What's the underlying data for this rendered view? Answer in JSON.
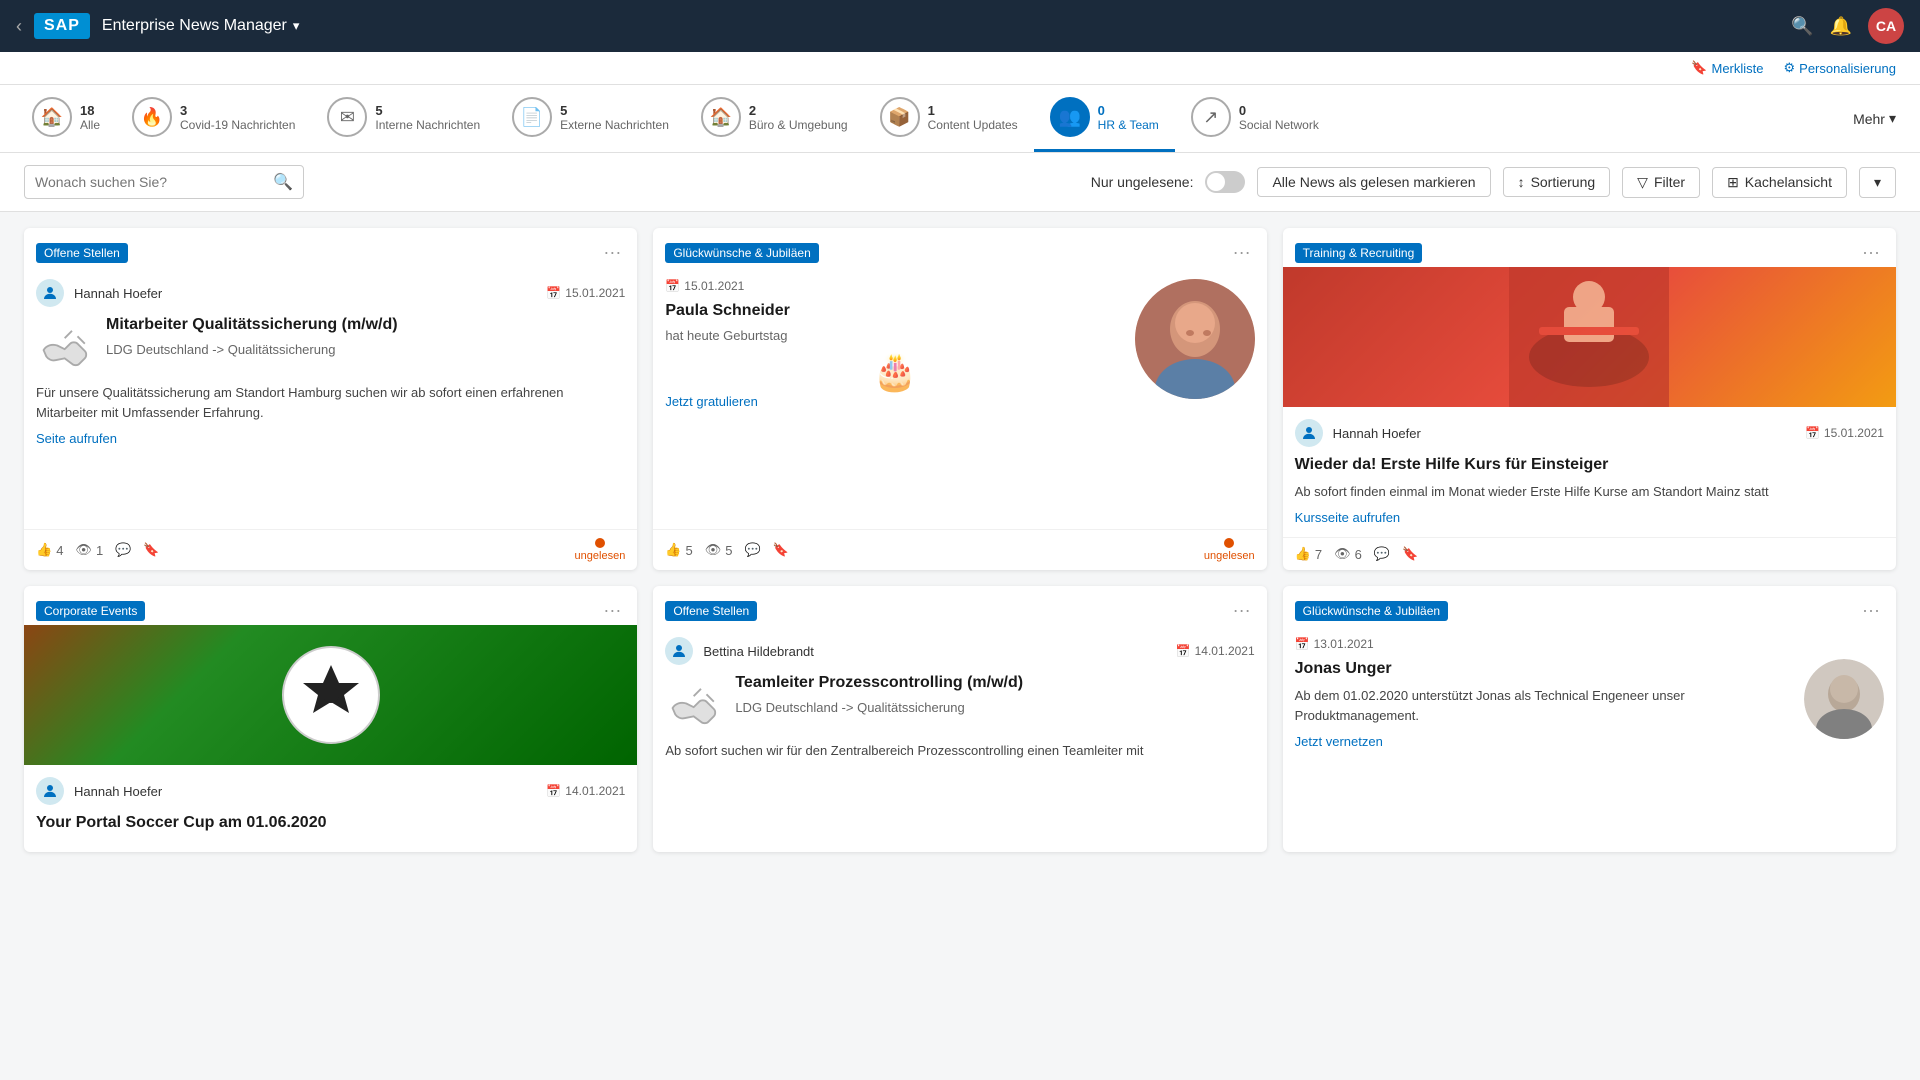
{
  "header": {
    "back_label": "‹",
    "sap_label": "SAP",
    "app_title": "Enterprise News Manager",
    "dropdown_arrow": "▾",
    "search_tooltip": "Search",
    "notification_tooltip": "Notifications",
    "avatar_initials": "CA"
  },
  "toolbar": {
    "merkliste_icon": "🔖",
    "merkliste_label": "Merkliste",
    "personalisierung_icon": "⚙",
    "personalisierung_label": "Personalisierung"
  },
  "categories": [
    {
      "id": "alle",
      "icon": "🏠",
      "count": "18",
      "label": "Alle",
      "active": false
    },
    {
      "id": "covid",
      "icon": "🔥",
      "count": "3",
      "label": "Covid-19 Nachrichten",
      "active": false
    },
    {
      "id": "intern",
      "icon": "✉",
      "count": "5",
      "label": "Interne Nachrichten",
      "active": false
    },
    {
      "id": "extern",
      "icon": "📄",
      "count": "5",
      "label": "Externe Nachrichten",
      "active": false
    },
    {
      "id": "buero",
      "icon": "🏠",
      "count": "2",
      "label": "Büro & Umgebung",
      "active": false
    },
    {
      "id": "content",
      "icon": "📦",
      "count": "1",
      "label": "Content Updates",
      "active": false
    },
    {
      "id": "hr",
      "icon": "👥",
      "count": "0",
      "label": "HR & Team",
      "active": true
    },
    {
      "id": "social",
      "icon": "↗",
      "count": "0",
      "label": "Social Network",
      "active": false
    }
  ],
  "mehr_label": "Mehr",
  "search": {
    "placeholder": "Wonach suchen Sie?",
    "nur_ungelesene": "Nur ungelesene:",
    "alle_gelesen_btn": "Alle News als gelesen markieren",
    "sortierung_btn": "Sortierung",
    "filter_btn": "Filter",
    "kachelansicht_btn": "Kachelansicht"
  },
  "cards": [
    {
      "id": "card1",
      "tag": "Offene Stellen",
      "tag_class": "tag-offene",
      "author": "Hannah Hoefer",
      "date": "15.01.2021",
      "title": "Mitarbeiter Qualitätssicherung (m/w/d)",
      "subtitle": "LDG Deutschland -> Qualitätssicherung",
      "text": "Für unsere Qualitätssicherung am Standort Hamburg suchen wir ab sofort einen erfahrenen Mitarbeiter mit Umfassender Erfahrung.",
      "link": "Seite aufrufen",
      "likes": "4",
      "views": "1",
      "unread": true,
      "type": "handshake"
    },
    {
      "id": "card2",
      "tag": "Glückwünsche & Jubiläen",
      "tag_class": "tag-gluck",
      "date": "15.01.2021",
      "title": "Paula Schneider",
      "subtitle": "hat heute Geburtstag",
      "link": "Jetzt gratulieren",
      "likes": "5",
      "views": "5",
      "unread": true,
      "type": "birthday"
    },
    {
      "id": "card3",
      "tag": "Training & Recruiting",
      "tag_class": "tag-training",
      "author": "Hannah Hoefer",
      "date": "15.01.2021",
      "title": "Wieder da! Erste Hilfe Kurs für Einsteiger",
      "text": "Ab sofort finden einmal im Monat wieder Erste Hilfe Kurse am Standort Mainz statt",
      "link": "Kursseite aufrufen",
      "likes": "7",
      "views": "6",
      "unread": false,
      "type": "training-image"
    },
    {
      "id": "card4",
      "tag": "Corporate Events",
      "tag_class": "tag-corporate",
      "author": "Hannah Hoefer",
      "date": "14.01.2021",
      "title": "Your Portal Soccer Cup am 01.06.2020",
      "text": "",
      "link": "",
      "likes": "",
      "views": "",
      "unread": false,
      "type": "soccer-image"
    },
    {
      "id": "card5",
      "tag": "Offene Stellen",
      "tag_class": "tag-offene",
      "author": "Bettina Hildebrandt",
      "date": "14.01.2021",
      "title": "Teamleiter Prozesscontrolling (m/w/d)",
      "subtitle": "LDG Deutschland -> Qualitätssicherung",
      "text": "Ab sofort suchen wir für den Zentralbereich Prozesscontrolling einen Teamleiter mit",
      "link": "",
      "likes": "",
      "views": "",
      "unread": false,
      "type": "handshake"
    },
    {
      "id": "card6",
      "tag": "Glückwünsche & Jubiläen",
      "tag_class": "tag-gluck",
      "date": "13.01.2021",
      "title": "Jonas Unger",
      "text": "Ab dem 01.02.2020 unterstützt Jonas als Technical Engeneer unser Produktmanagement.",
      "link": "Jetzt vernetzen",
      "likes": "",
      "views": "",
      "unread": false,
      "type": "portrait"
    }
  ]
}
